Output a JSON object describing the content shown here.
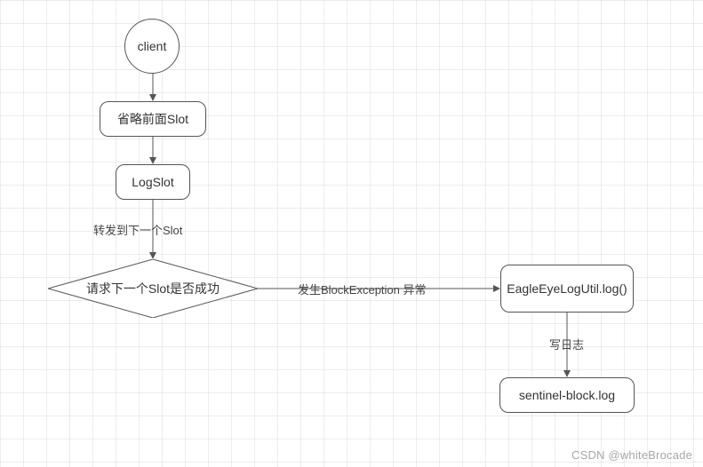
{
  "nodes": {
    "client": {
      "label": "client"
    },
    "omit_slot": {
      "label": "省略前面Slot"
    },
    "log_slot": {
      "label": "LogSlot"
    },
    "decision": {
      "label": "请求下一个Slot是否成功"
    },
    "eagle_eye": {
      "label": "EagleEyeLogUtil.log()"
    },
    "sentinel_log": {
      "label": "sentinel-block.log"
    }
  },
  "edges": {
    "forward_next": {
      "label": "转发到下一个Slot"
    },
    "block_exception": {
      "label": "发生BlockException 异常"
    },
    "write_log": {
      "label": "写日志"
    }
  },
  "watermark": "CSDN @whiteBrocade",
  "chart_data": {
    "type": "flowchart",
    "nodes": [
      {
        "id": "client",
        "shape": "circle",
        "label": "client"
      },
      {
        "id": "omit_slot",
        "shape": "rounded-rect",
        "label": "省略前面Slot"
      },
      {
        "id": "log_slot",
        "shape": "rounded-rect",
        "label": "LogSlot"
      },
      {
        "id": "decision",
        "shape": "diamond",
        "label": "请求下一个Slot是否成功"
      },
      {
        "id": "eagle_eye",
        "shape": "rounded-rect",
        "label": "EagleEyeLogUtil.log()"
      },
      {
        "id": "sentinel_log",
        "shape": "rounded-rect",
        "label": "sentinel-block.log"
      }
    ],
    "edges": [
      {
        "from": "client",
        "to": "omit_slot",
        "label": ""
      },
      {
        "from": "omit_slot",
        "to": "log_slot",
        "label": ""
      },
      {
        "from": "log_slot",
        "to": "decision",
        "label": "转发到下一个Slot"
      },
      {
        "from": "decision",
        "to": "eagle_eye",
        "label": "发生BlockException 异常"
      },
      {
        "from": "eagle_eye",
        "to": "sentinel_log",
        "label": "写日志"
      }
    ]
  }
}
